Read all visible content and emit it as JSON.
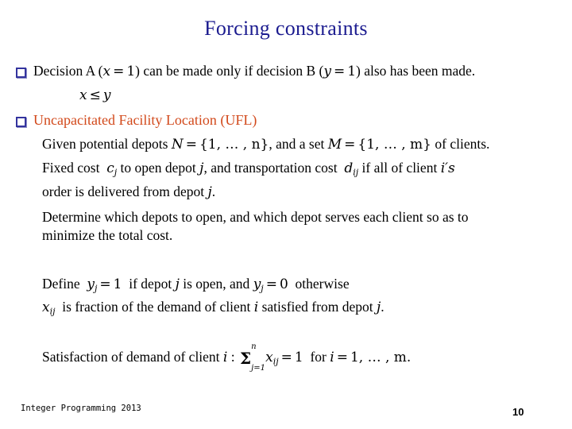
{
  "slide": {
    "title": "Forcing constraints",
    "title_color": "#1b1b8f",
    "bullet_color": "#33339e",
    "heading_color": "#d2491b"
  },
  "bullet1": {
    "pre": "Decision A (",
    "var_x": "x",
    "eq1": "=",
    "one_a": "1",
    "mid": ") can be made only if decision B (",
    "var_y": "y",
    "eq2": "=",
    "one_b": "1",
    "post": ") also has been made.",
    "constraint": {
      "lhs": "x",
      "rel": "≤",
      "rhs": "y"
    }
  },
  "bullet2": {
    "heading": "Uncapacitated Facility Location (UFL)",
    "line_given": {
      "p1": "Given potential depots",
      "set_N": "N",
      "eq1": "=",
      "braceN": "{1, … , n}",
      "p2": ", and a set",
      "set_M": "M",
      "eq2": "=",
      "braceM": "{1, … , m}",
      "p3": "of clients."
    },
    "line_fixed": {
      "p1": "Fixed cost",
      "c_base": "c",
      "c_sub": "j",
      "p2": "to open depot",
      "j1": "j",
      "p3": ", and transportation cost",
      "d_base": "d",
      "d_sub": "ij",
      "p4": "if all of client",
      "i_prime": "i′s"
    },
    "line_order": "order is delivered from depot j.",
    "line_order_pre": "order is delivered from depot",
    "line_order_var": "j",
    "line_order_post": ".",
    "line_determine": "Determine which depots to open, and which depot serves each client so as to",
    "line_minimize": "minimize the total cost."
  },
  "define": {
    "p1": "Define",
    "y_base1": "y",
    "y_sub1": "j",
    "eq1": "=",
    "val1": "1",
    "p2": "if depot",
    "j_var": "j",
    "p3": "is open, and",
    "y_base2": "y",
    "y_sub2": "j",
    "eq2": "=",
    "val2": "0",
    "p4": "otherwise",
    "x_base": "x",
    "x_sub": "ij",
    "p5": "is fraction of the demand of client",
    "i_var": "i",
    "p6": "satisfied from depot",
    "j_var2": "j",
    "p7": "."
  },
  "satisfaction": {
    "p1": "Satisfaction of demand of client",
    "i_var": "i",
    "colon": ":",
    "sigma": "Σ",
    "sum_top": "n",
    "sum_bottom": "j=1",
    "x_base": "x",
    "x_sub": "ij",
    "eq": "=",
    "val": "1",
    "p2": "for",
    "i_var2": "i",
    "eq2": "=",
    "range": "1, … , m."
  },
  "footer": {
    "left_text": "Integer Programming 2013",
    "page_number": "10"
  }
}
